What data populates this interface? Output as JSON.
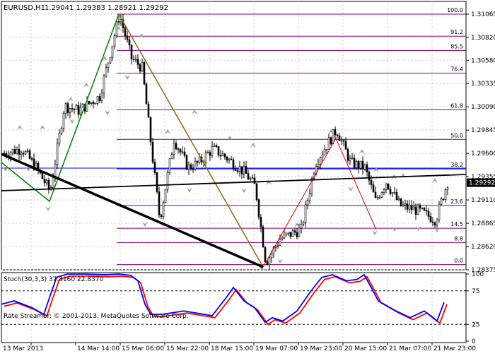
{
  "window": {
    "symbol_caption": "EURUSD,H1",
    "ohlc": "1.29041 1.29383 1.28921 1.29292"
  },
  "price_axis": {
    "ticks": [
      "1.31065",
      "1.30820",
      "1.30580",
      "1.30335",
      "1.30090",
      "1.29845",
      "1.29600",
      "1.29355",
      "1.29110",
      "1.28865",
      "1.28620",
      "1.28375"
    ],
    "current_price": "1.29292",
    "range": [
      1.2826,
      1.312
    ]
  },
  "time_axis": {
    "labels": [
      "13 Mar 2013",
      "14 Mar 14:00",
      "15 Mar 06:00",
      "15 Mar 22:00",
      "18 Mar 15:00",
      "19 Mar 07:00",
      "19 Mar 23:00",
      "20 Mar 15:00",
      "21 Mar 07:00",
      "21 Mar 23:00"
    ]
  },
  "fibonacci": {
    "levels": [
      "100.0",
      "91.2",
      "85.5",
      "76.4",
      "61.8",
      "50.0",
      "38.2",
      "23.6",
      "14.5",
      "8.8",
      "0.0"
    ],
    "high": 1.31065,
    "low": 1.2843
  },
  "indicator": {
    "caption": "Stoch(30,3,3) 37.3160 22.8370",
    "levels": [
      "100",
      "75",
      "25",
      "0"
    ],
    "watermark": "Rate Streamer: © 2001-2013, MetaQuotes Software Corp."
  },
  "colors": {
    "background": "#ffffff",
    "grid": "#c8c8c8",
    "candles": "#000000",
    "fib_lines": "#800080",
    "channel_lines": "#0000ff",
    "zigzag_up": "#008000",
    "zigzag_down": "#8b6914",
    "zigzag_red": "#dd0000",
    "trendline": "#000000",
    "stoch_main": "#0000ff",
    "stoch_signal": "#ff0000",
    "fractal_arrows": "#a0a0a0",
    "price_label_bg": "#000000"
  },
  "icons": {
    "fractal_up": "fractal-up-arrow-icon",
    "fractal_down": "fractal-down-arrow-icon"
  }
}
